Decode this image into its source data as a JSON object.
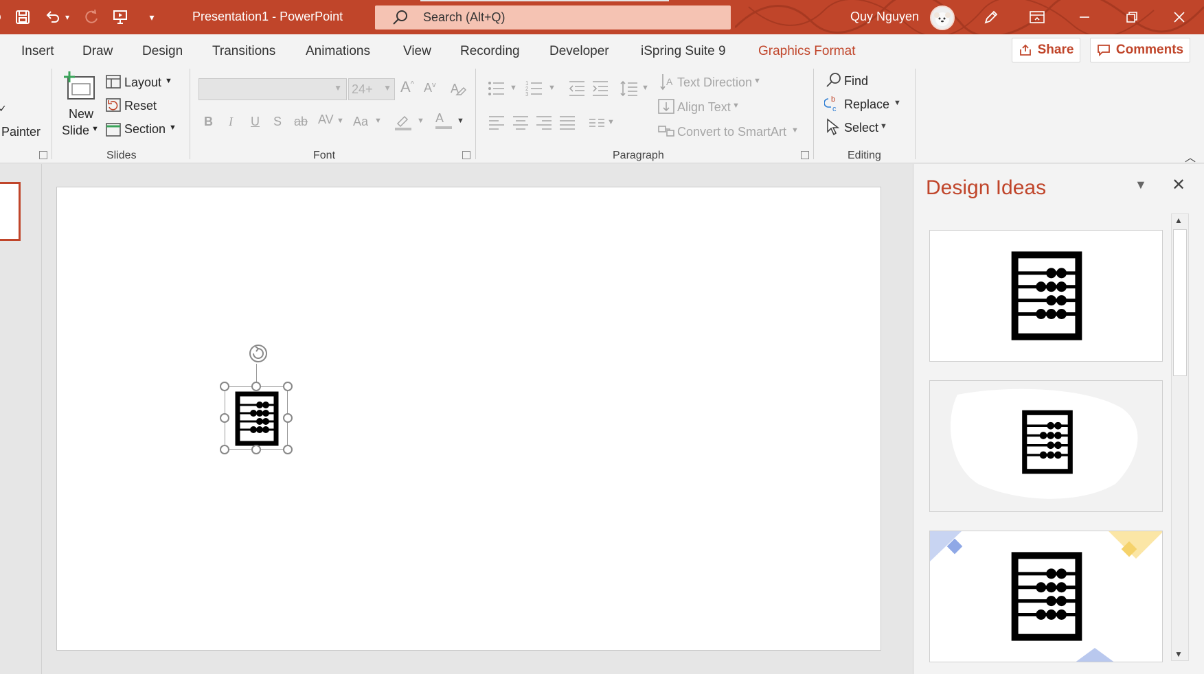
{
  "titlebar": {
    "doc_title": "Presentation1  -  PowerPoint",
    "search_placeholder": "Search (Alt+Q)",
    "user_name": "Quy Nguyen",
    "quick_access": [
      "save-icon",
      "undo-icon",
      "redo-icon",
      "present-icon",
      "customize-icon"
    ],
    "window_controls": [
      "pen-icon",
      "ribbon-display-icon",
      "minimize-icon",
      "restore-icon",
      "close-icon"
    ]
  },
  "tabs": {
    "items": [
      "Insert",
      "Draw",
      "Design",
      "Transitions",
      "Animations",
      "View",
      "Recording",
      "Developer",
      "iSpring Suite 9",
      "Graphics Format"
    ],
    "active": "Graphics Format",
    "share_label": "Share",
    "comments_label": "Comments"
  },
  "ribbon": {
    "clipboard": {
      "painter_label": "Painter"
    },
    "slides": {
      "new_slide_line1": "New",
      "new_slide_line2": "Slide",
      "layout_label": "Layout",
      "reset_label": "Reset",
      "section_label": "Section",
      "group_label": "Slides"
    },
    "font": {
      "font_name_value": "",
      "font_size_value": "24+",
      "bold": "B",
      "italic": "I",
      "underline": "U",
      "shadow": "S",
      "strikethrough": "ab",
      "spacing": "AV",
      "change_case": "Aa",
      "font_color": "A",
      "grow": "A",
      "shrink": "A",
      "group_label": "Font"
    },
    "paragraph": {
      "text_direction_label": "Text Direction",
      "align_text_label": "Align Text",
      "convert_smartart_label": "Convert to SmartArt",
      "group_label": "Paragraph"
    },
    "editing": {
      "find_label": "Find",
      "replace_label": "Replace",
      "select_label": "Select",
      "group_label": "Editing"
    }
  },
  "design_ideas": {
    "title": "Design Ideas",
    "cards": [
      {
        "style": "plain-white"
      },
      {
        "style": "gray-brush"
      },
      {
        "style": "color-corners"
      }
    ]
  },
  "colors": {
    "accent": "#c0452a",
    "search_bg": "#f5c3b3",
    "ribbon_bg": "#f3f3f3",
    "workspace_bg": "#e6e6e6"
  }
}
